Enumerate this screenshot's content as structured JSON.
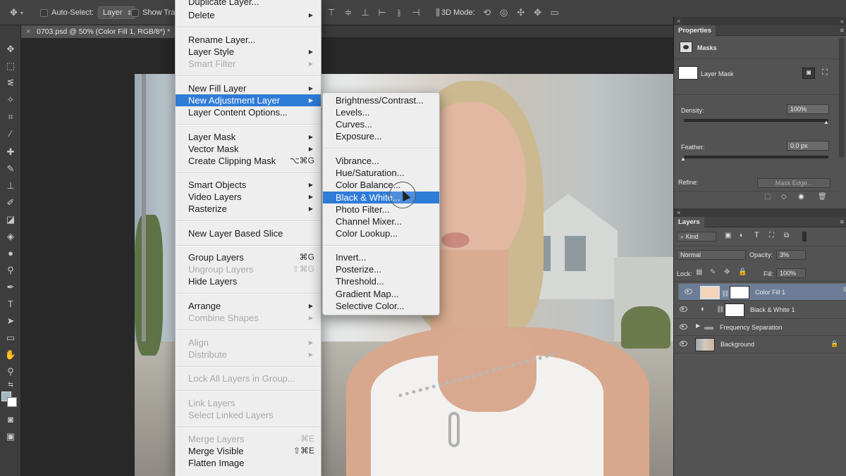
{
  "options_bar": {
    "auto_select_label": "Auto-Select:",
    "auto_select_value": "Layer",
    "show_transform_label": "Show Trans",
    "mode_3d_label": "3D Mode:"
  },
  "document_tab": {
    "title": "0703.psd @ 50% (Color Fill 1, RGB/8*) *"
  },
  "layer_menu": {
    "items": [
      {
        "label": "Duplicate Layer...",
        "enabled": true
      },
      {
        "label": "Delete",
        "enabled": true,
        "submenu": true
      },
      {
        "label": "Rename Layer...",
        "enabled": true
      },
      {
        "label": "Layer Style",
        "enabled": true,
        "submenu": true
      },
      {
        "label": "Smart Filter",
        "enabled": false,
        "submenu": true
      },
      {
        "label": "New Fill Layer",
        "enabled": true,
        "submenu": true
      },
      {
        "label": "New Adjustment Layer",
        "enabled": true,
        "submenu": true,
        "highlighted": true
      },
      {
        "label": "Layer Content Options...",
        "enabled": true
      },
      {
        "label": "Layer Mask",
        "enabled": true,
        "submenu": true
      },
      {
        "label": "Vector Mask",
        "enabled": true,
        "submenu": true
      },
      {
        "label": "Create Clipping Mask",
        "enabled": true,
        "shortcut": "⌥⌘G"
      },
      {
        "label": "Smart Objects",
        "enabled": true,
        "submenu": true
      },
      {
        "label": "Video Layers",
        "enabled": true,
        "submenu": true
      },
      {
        "label": "Rasterize",
        "enabled": true,
        "submenu": true
      },
      {
        "label": "New Layer Based Slice",
        "enabled": true
      },
      {
        "label": "Group Layers",
        "enabled": true,
        "shortcut": "⌘G"
      },
      {
        "label": "Ungroup Layers",
        "enabled": false,
        "shortcut": "⇧⌘G"
      },
      {
        "label": "Hide Layers",
        "enabled": true
      },
      {
        "label": "Arrange",
        "enabled": true,
        "submenu": true
      },
      {
        "label": "Combine Shapes",
        "enabled": false,
        "submenu": true
      },
      {
        "label": "Align",
        "enabled": false,
        "submenu": true
      },
      {
        "label": "Distribute",
        "enabled": false,
        "submenu": true
      },
      {
        "label": "Lock All Layers in Group...",
        "enabled": false
      },
      {
        "label": "Link Layers",
        "enabled": false
      },
      {
        "label": "Select Linked Layers",
        "enabled": false
      },
      {
        "label": "Merge Layers",
        "enabled": false,
        "shortcut": "⌘E"
      },
      {
        "label": "Merge Visible",
        "enabled": true,
        "shortcut": "⇧⌘E"
      },
      {
        "label": "Flatten Image",
        "enabled": true
      }
    ]
  },
  "adjustment_submenu": {
    "items": [
      {
        "label": "Brightness/Contrast..."
      },
      {
        "label": "Levels..."
      },
      {
        "label": "Curves..."
      },
      {
        "label": "Exposure..."
      },
      {
        "label": "Vibrance..."
      },
      {
        "label": "Hue/Saturation..."
      },
      {
        "label": "Color Balance..."
      },
      {
        "label": "Black & White...",
        "highlighted": true
      },
      {
        "label": "Photo Filter..."
      },
      {
        "label": "Channel Mixer..."
      },
      {
        "label": "Color Lookup..."
      },
      {
        "label": "Invert..."
      },
      {
        "label": "Posterize..."
      },
      {
        "label": "Threshold..."
      },
      {
        "label": "Gradient Map..."
      },
      {
        "label": "Selective Color..."
      }
    ]
  },
  "properties_panel": {
    "tab": "Properties",
    "section": "Masks",
    "mask_type": "Layer Mask",
    "density_label": "Density:",
    "density_value": "100%",
    "feather_label": "Feather:",
    "feather_value": "0.0 px",
    "refine_label": "Refine:",
    "mask_edge_button": "Mask Edge..."
  },
  "layers_panel": {
    "tab": "Layers",
    "filter_kind": "Kind",
    "blend_mode": "Normal",
    "opacity_label": "Opacity:",
    "opacity_value": "3%",
    "lock_label": "Lock:",
    "fill_label": "Fill:",
    "fill_value": "100%",
    "layers": [
      {
        "name": "Color Fill 1",
        "selected": true,
        "thumb_color": "#f3d3b9"
      },
      {
        "name": "Black & White 1",
        "selected": false
      },
      {
        "name": "Frequency Separation",
        "selected": false,
        "group": true
      },
      {
        "name": "Background",
        "selected": false,
        "locked": true
      }
    ]
  },
  "colors": {
    "menu_highlight": "#2f7bd8",
    "foreground_swatch": "#9fb9c4",
    "selected_layer_bg": "#6d7d97"
  }
}
